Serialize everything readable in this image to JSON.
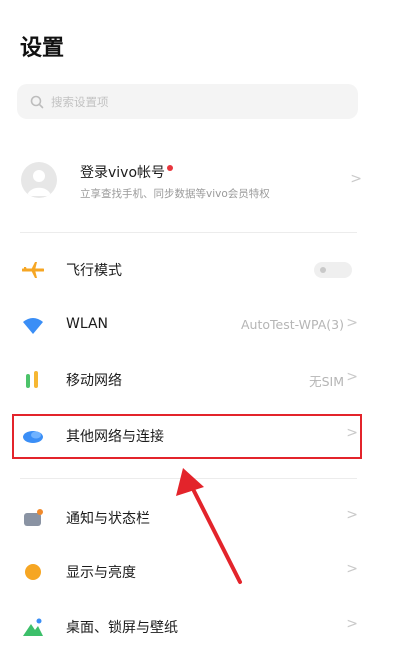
{
  "page_title": "设置",
  "search": {
    "placeholder": "搜索设置项",
    "icon": "search-icon"
  },
  "account": {
    "name": "登录vivo帐号",
    "subtitle": "立享查找手机、同步数据等vivo会员特权",
    "has_notification_dot": true
  },
  "settings_items": [
    {
      "label": "飞行模式",
      "icon": "airplane-icon",
      "control": "toggle",
      "toggle_on": false
    },
    {
      "label": "WLAN",
      "icon": "wifi-icon",
      "value": "AutoTest-WPA(3)"
    },
    {
      "label": "移动网络",
      "icon": "mobile-network-icon",
      "value": "无SIM"
    },
    {
      "label": "其他网络与连接",
      "icon": "other-network-icon",
      "highlighted": true
    },
    {
      "label": "通知与状态栏",
      "icon": "notification-icon"
    },
    {
      "label": "显示与亮度",
      "icon": "display-icon"
    },
    {
      "label": "桌面、锁屏与壁纸",
      "icon": "wallpaper-icon"
    }
  ],
  "chevron_glyph": ">",
  "annotation": {
    "highlight_color": "#e3242b",
    "arrow_color": "#e3242b"
  }
}
